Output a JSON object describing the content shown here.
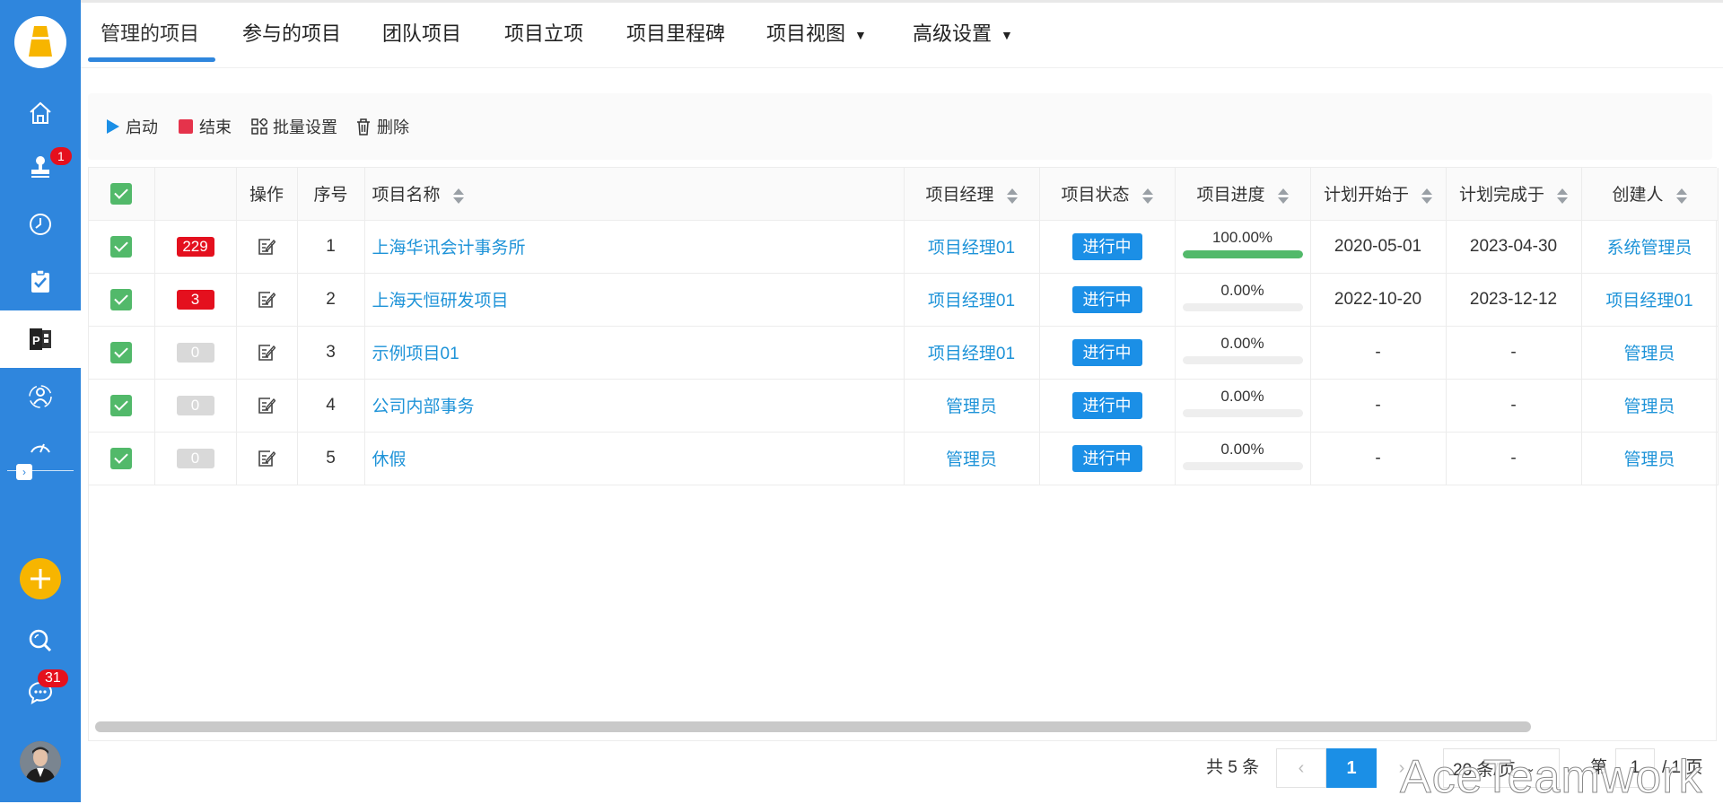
{
  "sidebar": {
    "badges": {
      "stamp": "1",
      "chat": "31"
    },
    "collapse_glyph": "›"
  },
  "tabs": [
    {
      "label": "管理的项目"
    },
    {
      "label": "参与的项目"
    },
    {
      "label": "团队项目"
    },
    {
      "label": "项目立项"
    },
    {
      "label": "项目里程碑"
    },
    {
      "label": "项目视图"
    },
    {
      "label": "高级设置"
    }
  ],
  "toolbar": {
    "start": "启动",
    "end": "结束",
    "batch": "批量设置",
    "delete": "删除"
  },
  "table": {
    "headers": {
      "op": "操作",
      "no": "序号",
      "name": "项目名称",
      "manager": "项目经理",
      "status": "项目状态",
      "progress": "项目进度",
      "start": "计划开始于",
      "finish": "计划完成于",
      "creator": "创建人"
    },
    "rows": [
      {
        "count": "229",
        "no": "1",
        "name": "上海华讯会计事务所",
        "manager": "项目经理01",
        "status": "进行中",
        "progress_text": "100.00%",
        "progress": 1.0,
        "start": "2020-05-01",
        "finish": "2023-04-30",
        "creator": "系统管理员"
      },
      {
        "count": "3",
        "no": "2",
        "name": "上海天恒研发项目",
        "manager": "项目经理01",
        "status": "进行中",
        "progress_text": "0.00%",
        "progress": 0,
        "start": "2022-10-20",
        "finish": "2023-12-12",
        "creator": "项目经理01"
      },
      {
        "count": "0",
        "no": "3",
        "name": "示例项目01",
        "manager": "项目经理01",
        "status": "进行中",
        "progress_text": "0.00%",
        "progress": 0,
        "start": "-",
        "finish": "-",
        "creator": "管理员"
      },
      {
        "count": "0",
        "no": "4",
        "name": "公司内部事务",
        "manager": "管理员",
        "status": "进行中",
        "progress_text": "0.00%",
        "progress": 0,
        "start": "-",
        "finish": "-",
        "creator": "管理员"
      },
      {
        "count": "0",
        "no": "5",
        "name": "休假",
        "manager": "管理员",
        "status": "进行中",
        "progress_text": "0.00%",
        "progress": 0,
        "start": "-",
        "finish": "-",
        "creator": "管理员"
      }
    ]
  },
  "pagination": {
    "total": "共 5 条",
    "prev": "‹",
    "current": "1",
    "next": "›",
    "page_size": "20 条/页",
    "goto_prefix": "第",
    "goto_value": "1",
    "goto_suffix": "/ 1 页"
  },
  "watermark": "AceTeamwork",
  "colors": {
    "sidebar": "#2f86dd",
    "link": "#1e93d8",
    "status": "#1b8fe6",
    "check": "#52b96a",
    "badge": "#e4101e"
  }
}
